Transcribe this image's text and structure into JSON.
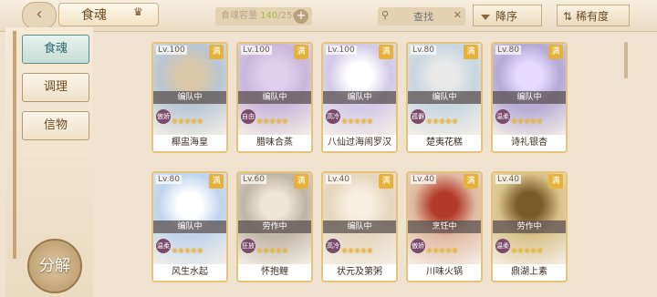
{
  "header": {
    "back_icon": "chevron-left-icon",
    "title": "食魂",
    "crown_icon": "crown-icon",
    "capacity_label": "食魂容量",
    "capacity_current": "140",
    "capacity_max": "/250",
    "search_placeholder": "查找",
    "sort_order_label": "降序",
    "sort_key_label": "稀有度"
  },
  "sidebar": {
    "tabs": [
      {
        "label": "食魂"
      },
      {
        "label": "调理"
      },
      {
        "label": "信物"
      }
    ],
    "decompose_label": "分解"
  },
  "cards": [
    {
      "level": "Lv.100",
      "badge": "满",
      "status": "编队中",
      "type": "傲娇",
      "name": "椰盅海皇",
      "stars": "◉◉◉◉◉",
      "bg": "#b9c6d4",
      "accent": "#d8c8a8"
    },
    {
      "level": "Lv.100",
      "badge": "满",
      "status": "编队中",
      "type": "自由",
      "name": "腊味合蒸",
      "stars": "◉◉◉◉◉",
      "bg": "#c9b7d9",
      "accent": "#e0d0f0"
    },
    {
      "level": "Lv.100",
      "badge": "满",
      "status": "编队中",
      "type": "高冷",
      "name": "八仙过海闹罗汉",
      "stars": "◉◉◉◉◉",
      "bg": "#d1c9e6",
      "accent": "#ffffff"
    },
    {
      "level": "Lv.80",
      "badge": "满",
      "status": "编队中",
      "type": "孤僻",
      "name": "楚夷花糕",
      "stars": "◉◉◉◉◉",
      "bg": "#c8d6e0",
      "accent": "#e8e8e8"
    },
    {
      "level": "Lv.80",
      "badge": "满",
      "status": "编队中",
      "type": "温柔",
      "name": "诗礼银杏",
      "stars": "◉◉◉◉◉",
      "bg": "#b3a9d4",
      "accent": "#e6dbff"
    },
    {
      "level": "Lv.80",
      "badge": "满",
      "status": "编队中",
      "type": "温柔",
      "name": "风生水起",
      "stars": "◉◉◉◉◉",
      "bg": "#c0d4ec",
      "accent": "#ffffff"
    },
    {
      "level": "Lv.60",
      "badge": "满",
      "status": "劳作中",
      "type": "狂放",
      "name": "怀抱鲤",
      "stars": "◉◉◉◉◉",
      "bg": "#bfb5a6",
      "accent": "#f0e6d6"
    },
    {
      "level": "Lv.40",
      "badge": "满",
      "status": "编队中",
      "type": "高冷",
      "name": "状元及第粥",
      "stars": "◉◉◉◉◉",
      "bg": "#e4d6bc",
      "accent": "#f6efe2"
    },
    {
      "level": "Lv.40",
      "badge": "满",
      "status": "烹饪中",
      "type": "傲娇",
      "name": "川味火锅",
      "stars": "◉◉◉◉◉",
      "bg": "#e0b9a0",
      "accent": "#b23b2b"
    },
    {
      "level": "Lv.40",
      "badge": "满",
      "status": "劳作中",
      "type": "温柔",
      "name": "鼎湖上素",
      "stars": "◉◉◉◉◉",
      "bg": "#d9c28a",
      "accent": "#7a5a2a"
    }
  ],
  "colors": {
    "frame": "#e4c47c",
    "accent": "#2f6a6c"
  }
}
